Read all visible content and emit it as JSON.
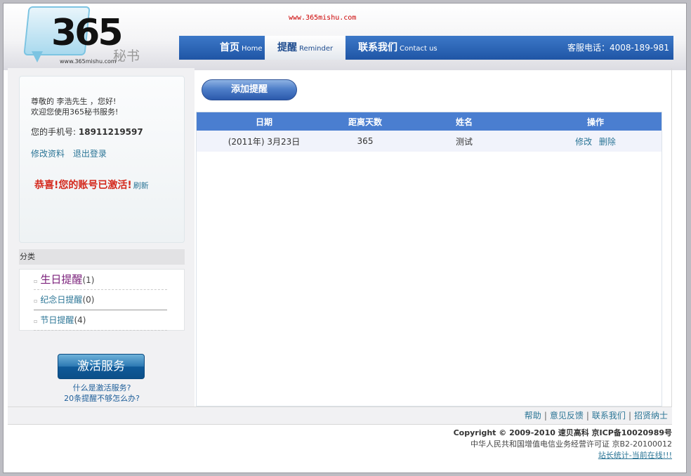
{
  "header": {
    "logo_number": "365",
    "logo_cn": "秘书",
    "logo_url": "www.365mishu.com",
    "site_url": "www.365mishu.com",
    "nav": [
      {
        "cn": "首页",
        "en": "Home"
      },
      {
        "cn": "提醒",
        "en": "Reminder"
      },
      {
        "cn": "联系我们",
        "en": "Contact us"
      }
    ],
    "hotline": "客服电话：4008-189-981"
  },
  "sidebar": {
    "greeting": "尊敬的 李浩先生 ，您好!",
    "welcome": "欢迎您使用365秘书服务!",
    "phone_label": "您的手机号:",
    "phone_number": "18911219597",
    "edit_profile": "修改资料",
    "logout": "退出登录",
    "activated_text": "恭喜!您的账号已激活!",
    "refresh": "刷新",
    "category_title": "分类",
    "categories": [
      {
        "name": "生日提醒",
        "count": "(1)"
      },
      {
        "name": "纪念日提醒",
        "count": "(0)"
      },
      {
        "name": "节日提醒",
        "count": "(4)"
      }
    ],
    "activate_button": "激活服务",
    "help1": "什么是激活服务?",
    "help2": "20条提醒不够怎么办?"
  },
  "main": {
    "add_button": "添加提醒",
    "columns": [
      "日期",
      "距离天数",
      "姓名",
      "操作"
    ],
    "rows": [
      {
        "date": "(2011年) 3月23日",
        "days": "365",
        "name": "测试",
        "edit": "修改",
        "delete": "删除"
      }
    ]
  },
  "footer": {
    "links": [
      "帮助",
      "意见反馈",
      "联系我们",
      "招贤纳士"
    ],
    "copyright": "Copyright © 2009-2010  速贝高科       京ICP备10020989号",
    "license": "中华人民共和国增值电信业务经营许可证  京B2-20100012",
    "stats": "站长统计-当前在线!!!"
  },
  "colors": {
    "nav_blue": "#1f55a5",
    "table_header": "#4a7ed0",
    "link": "#2b7596",
    "alert_red": "#d4281c"
  }
}
